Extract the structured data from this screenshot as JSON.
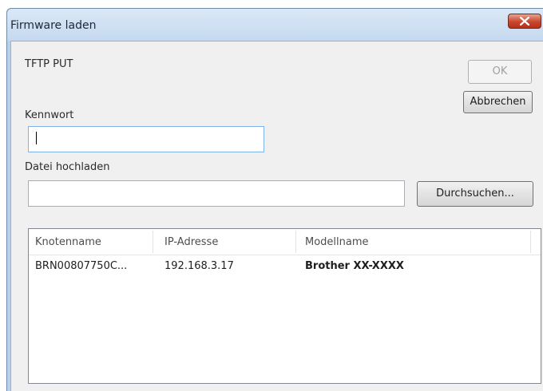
{
  "window": {
    "title": "Firmware laden"
  },
  "form": {
    "protocol_label": "TFTP PUT",
    "password_label": "Kennwort",
    "password_value": "",
    "upload_label": "Datei hochladen",
    "upload_value": ""
  },
  "buttons": {
    "ok": "OK",
    "cancel": "Abbrechen",
    "browse": "Durchsuchen..."
  },
  "table": {
    "columns": [
      "Knotenname",
      "IP-Adresse",
      "Modellname"
    ],
    "rows": [
      [
        "BRN00807750C...",
        "192.168.3.17",
        "Brother XX-XXXX"
      ]
    ]
  },
  "icons": {
    "close": "close-icon"
  },
  "colors": {
    "titlebar": "#c4d9ef",
    "close_button": "#c9452d",
    "dialog_body": "#f0f0f0"
  }
}
